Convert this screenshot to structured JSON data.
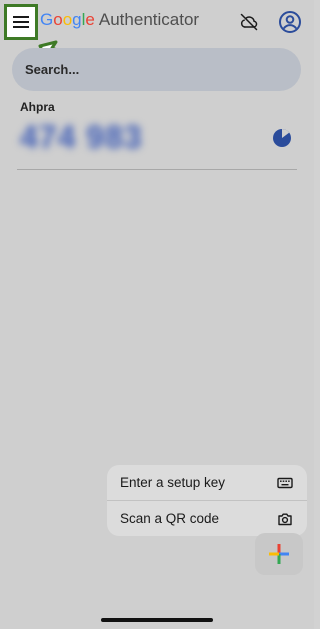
{
  "header": {
    "brand_google_letters": [
      {
        "char": "G",
        "color": "#4285F4"
      },
      {
        "char": "o",
        "color": "#EA4335"
      },
      {
        "char": "o",
        "color": "#FBBC05"
      },
      {
        "char": "g",
        "color": "#4285F4"
      },
      {
        "char": "l",
        "color": "#34A853"
      },
      {
        "char": "e",
        "color": "#EA4335"
      }
    ],
    "brand_suffix": "Authenticator",
    "menu_icon": "hamburger-menu-icon",
    "cloud_icon": "cloud-off-icon",
    "account_icon": "account-circle-icon"
  },
  "search": {
    "placeholder": "Search..."
  },
  "accounts": [
    {
      "name": "Ahpra",
      "code": "474 983",
      "timer_icon": "countdown-timer-icon"
    }
  ],
  "add_menu": {
    "items": [
      {
        "label": "Enter a setup key",
        "icon": "keyboard-icon"
      },
      {
        "label": "Scan a QR code",
        "icon": "camera-icon"
      }
    ]
  },
  "fab": {
    "icon": "add-plus-icon",
    "colors": [
      "#EA4335",
      "#4285F4",
      "#34A853",
      "#FBBC05"
    ]
  },
  "colors": {
    "highlight": "#3e7a26",
    "otp": "#3c5bb6",
    "search_bg": "#b9bec7"
  }
}
